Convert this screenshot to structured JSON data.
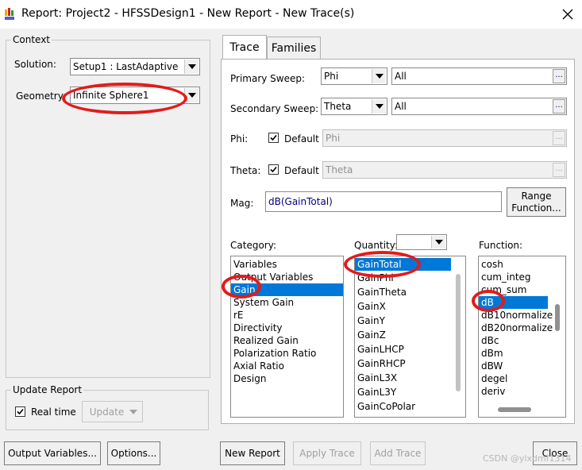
{
  "window": {
    "title": "Report: Project2 - HFSSDesign1 - New Report - New Trace(s)",
    "close_label": "✕"
  },
  "context": {
    "legend": "Context",
    "solution_label": "Solution:",
    "solution_value": "Setup1 : LastAdaptive",
    "geometry_label": "Geometry:",
    "geometry_value": "Infinite Sphere1"
  },
  "update_report": {
    "legend": "Update Report",
    "realtime_label": "Real time",
    "realtime_checked": true,
    "update_label": "Update"
  },
  "tabs": [
    {
      "label": "Trace",
      "active": true
    },
    {
      "label": "Families",
      "active": false
    }
  ],
  "trace": {
    "primary_sweep_label": "Primary Sweep:",
    "primary_sweep_value": "Phi",
    "primary_sweep_range": "All",
    "secondary_sweep_label": "Secondary Sweep:",
    "secondary_sweep_value": "Theta",
    "secondary_sweep_range": "All",
    "phi_label": "Phi:",
    "phi_default_label": "Default",
    "phi_value": "Phi",
    "theta_label": "Theta:",
    "theta_default_label": "Default",
    "theta_value": "Theta",
    "mag_label": "Mag:",
    "mag_value": "dB(GainTotal)",
    "range_function_line1": "Range",
    "range_function_line2": "Function...",
    "ellipsis": "..."
  },
  "category": {
    "label": "Category:",
    "items": [
      "Variables",
      "Output Variables",
      "Gain",
      "System Gain",
      "rE",
      "Directivity",
      "Realized Gain",
      "Polarization Ratio",
      "Axial Ratio",
      "Design"
    ],
    "selected": "Gain"
  },
  "quantity": {
    "label": "Quantity:",
    "filter_value": "",
    "items": [
      "GainTotal",
      "GainPhi",
      "GainTheta",
      "GainX",
      "GainY",
      "GainZ",
      "GainLHCP",
      "GainRHCP",
      "GainL3X",
      "GainL3Y",
      "GainCoPolar"
    ],
    "selected": "GainTotal"
  },
  "function": {
    "label": "Function:",
    "items": [
      "cosh",
      "cum_integ",
      "cum_sum",
      "dB",
      "dB10normalize",
      "dB20normalize",
      "dBc",
      "dBm",
      "dBW",
      "degel",
      "deriv"
    ],
    "selected": "dB"
  },
  "buttons": {
    "output_variables": "Output Variables...",
    "options": "Options...",
    "new_report": "New Report",
    "apply_trace": "Apply Trace",
    "add_trace": "Add Trace",
    "close": "Close"
  },
  "watermark": "CSDN @ylxdmf1314",
  "colors": {
    "selection": "#0078d7",
    "annotation_red": "#e31b1b",
    "mag_text": "#00007f"
  }
}
